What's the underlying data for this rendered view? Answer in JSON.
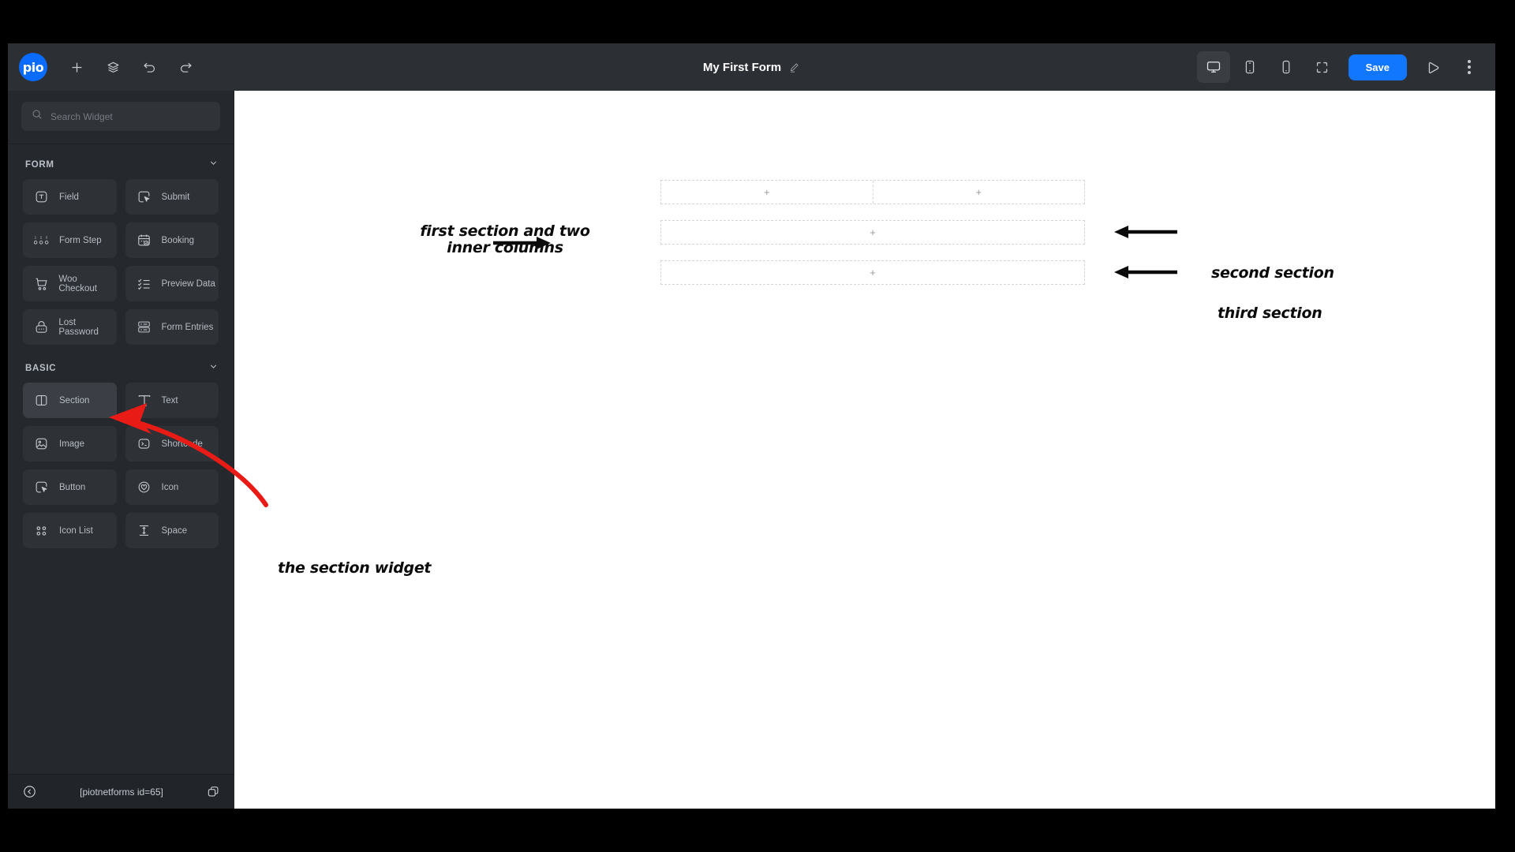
{
  "app": {
    "brand_logo_text": "pio",
    "accent_color": "#1277ff",
    "annotation_color": "#e81b16"
  },
  "topbar": {
    "title": "My First Form",
    "edit_icon": "pencil-icon",
    "add_icon": "plus-icon",
    "layers_icon": "layers-icon",
    "undo_icon": "undo-icon",
    "redo_icon": "redo-icon",
    "devices": [
      {
        "name": "desktop",
        "icon": "desktop-icon",
        "active": true
      },
      {
        "name": "tablet",
        "icon": "tablet-icon",
        "active": false
      },
      {
        "name": "mobile",
        "icon": "mobile-icon",
        "active": false
      },
      {
        "name": "fullscreen",
        "icon": "fullscreen-icon",
        "active": false
      }
    ],
    "save_label": "Save",
    "preview_icon": "play-icon",
    "more_icon": "kebab-menu-icon"
  },
  "sidebar": {
    "search": {
      "placeholder": "Search Widget",
      "icon": "search-icon"
    },
    "groups": [
      {
        "title": "FORM",
        "collapse_icon": "chevron-down-icon",
        "widgets": [
          {
            "label": "Field",
            "icon": "text-field-icon",
            "selected": false
          },
          {
            "label": "Submit",
            "icon": "submit-cursor-icon",
            "selected": false
          },
          {
            "label": "Form Step",
            "icon": "form-step-icon",
            "selected": false
          },
          {
            "label": "Booking",
            "icon": "calendar-check-icon",
            "selected": false
          },
          {
            "label": "Woo Checkout",
            "icon": "shopping-cart-icon",
            "selected": false
          },
          {
            "label": "Preview Data",
            "icon": "checklist-icon",
            "selected": false
          },
          {
            "label": "Lost Password",
            "icon": "lock-icon",
            "selected": false
          },
          {
            "label": "Form Entries",
            "icon": "server-rows-icon",
            "selected": false
          }
        ]
      },
      {
        "title": "BASIC",
        "collapse_icon": "chevron-down-icon",
        "widgets": [
          {
            "label": "Section",
            "icon": "section-columns-icon",
            "selected": true
          },
          {
            "label": "Text",
            "icon": "text-t-icon",
            "selected": false
          },
          {
            "label": "Image",
            "icon": "image-icon",
            "selected": false
          },
          {
            "label": "Shortcode",
            "icon": "terminal-icon",
            "selected": false
          },
          {
            "label": "Button",
            "icon": "button-cursor-icon",
            "selected": false
          },
          {
            "label": "Icon",
            "icon": "heart-circle-icon",
            "selected": false
          },
          {
            "label": "Icon List",
            "icon": "icon-list-icon",
            "selected": false
          },
          {
            "label": "Space",
            "icon": "vertical-space-icon",
            "selected": false
          }
        ]
      }
    ],
    "footer": {
      "back_icon": "chevron-left-circle-icon",
      "shortcode": "[piotnetforms id=65]",
      "copy_icon": "copy-icon"
    }
  },
  "canvas": {
    "sections": [
      {
        "name": "first-section",
        "columns": [
          {
            "add_label": "+"
          },
          {
            "add_label": "+"
          }
        ]
      },
      {
        "name": "second-section",
        "columns": [
          {
            "add_label": "+"
          }
        ]
      },
      {
        "name": "third-section",
        "columns": [
          {
            "add_label": "+"
          }
        ]
      }
    ]
  },
  "annotations": {
    "first": "first section and two\ninner columns",
    "second": "second section",
    "third": "third section",
    "widget": "the section widget"
  }
}
